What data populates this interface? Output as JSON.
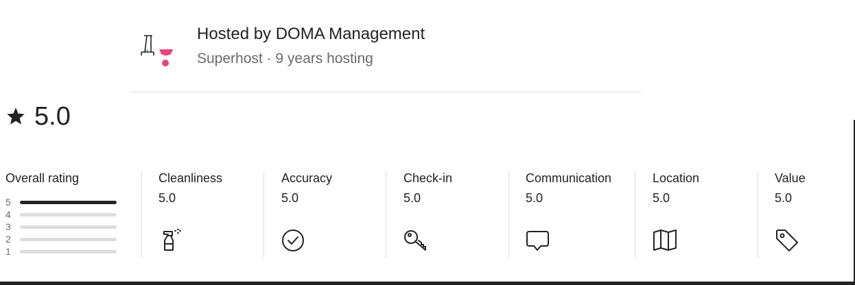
{
  "host": {
    "name": "Hosted by DOMA Management",
    "subtitle": "Superhost · 9 years hosting",
    "avatar_icon": "doma-logo"
  },
  "rating": {
    "icon": "star-icon",
    "value": "5.0"
  },
  "overall": {
    "title": "Overall rating",
    "distribution": [
      {
        "stars": "5",
        "fraction": 1.0
      },
      {
        "stars": "4",
        "fraction": 0
      },
      {
        "stars": "3",
        "fraction": 0
      },
      {
        "stars": "2",
        "fraction": 0
      },
      {
        "stars": "1",
        "fraction": 0
      }
    ]
  },
  "categories": [
    {
      "label": "Cleanliness",
      "value": "5.0",
      "icon": "spray-bottle-icon"
    },
    {
      "label": "Accuracy",
      "value": "5.0",
      "icon": "check-circle-icon"
    },
    {
      "label": "Check-in",
      "value": "5.0",
      "icon": "key-icon"
    },
    {
      "label": "Communication",
      "value": "5.0",
      "icon": "chat-bubble-icon"
    },
    {
      "label": "Location",
      "value": "5.0",
      "icon": "map-icon"
    },
    {
      "label": "Value",
      "value": "5.0",
      "icon": "tag-icon"
    }
  ],
  "colors": {
    "text": "#222222",
    "muted": "#6a6a6a",
    "divider": "#dddddd",
    "brand_pink": "#e8457c"
  }
}
